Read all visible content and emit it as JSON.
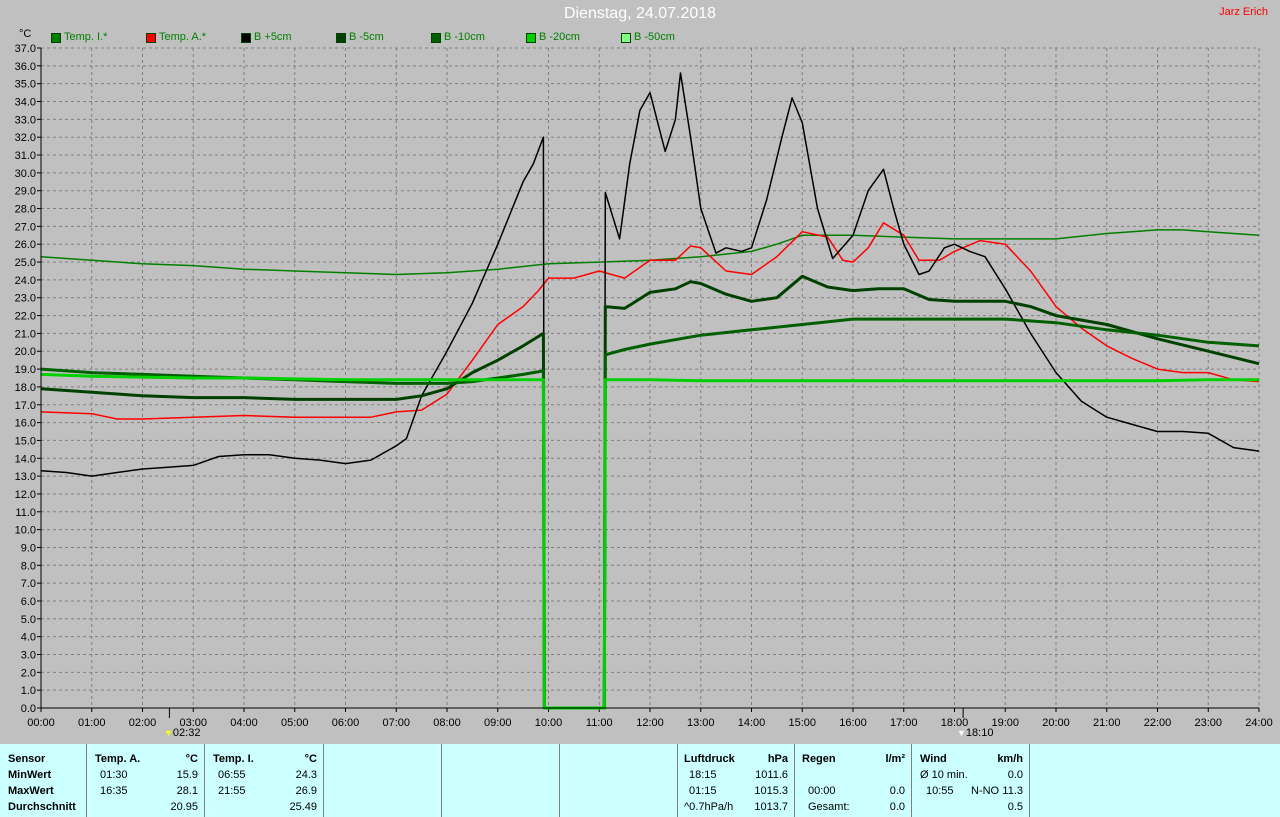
{
  "header": {
    "title": "Dienstag, 24.07.2018",
    "author": "Jarz Erich",
    "unit": "°C"
  },
  "colors": {
    "background": "#c0c0c0",
    "plot": "#ffffff",
    "panel": "#ccffff"
  },
  "markers": [
    {
      "time": 2.53,
      "label": "02:32"
    },
    {
      "time": 18.17,
      "label": "18:10"
    }
  ],
  "chart_data": {
    "type": "line",
    "title": "Dienstag, 24.07.2018",
    "ylabel": "°C",
    "xlim": [
      0,
      24
    ],
    "ylim": [
      0,
      37
    ],
    "x_tick_labels": [
      "00:00",
      "01:00",
      "02:00",
      "03:00",
      "04:00",
      "05:00",
      "06:00",
      "07:00",
      "08:00",
      "09:00",
      "10:00",
      "11:00",
      "12:00",
      "13:00",
      "14:00",
      "15:00",
      "16:00",
      "17:00",
      "18:00",
      "19:00",
      "20:00",
      "21:00",
      "22:00",
      "23:00",
      "24:00"
    ],
    "y_tick_labels": [
      "0.0",
      "1.0",
      "2.0",
      "3.0",
      "4.0",
      "5.0",
      "6.0",
      "7.0",
      "8.0",
      "9.0",
      "10.0",
      "11.0",
      "12.0",
      "13.0",
      "14.0",
      "15.0",
      "16.0",
      "17.0",
      "18.0",
      "19.0",
      "20.0",
      "21.0",
      "22.0",
      "23.0",
      "24.0",
      "25.0",
      "26.0",
      "27.0",
      "28.0",
      "29.0",
      "30.0",
      "31.0",
      "32.0",
      "33.0",
      "34.0",
      "35.0",
      "36.0",
      "37.0"
    ],
    "grid": true,
    "legend_position": "top-left",
    "series": [
      {
        "name": "Temp. I.*",
        "color": "#008000",
        "width": 1.5,
        "points": [
          [
            0,
            25.3
          ],
          [
            1,
            25.1
          ],
          [
            2,
            24.9
          ],
          [
            3,
            24.8
          ],
          [
            4,
            24.6
          ],
          [
            5,
            24.5
          ],
          [
            6,
            24.4
          ],
          [
            7,
            24.3
          ],
          [
            8,
            24.4
          ],
          [
            9,
            24.6
          ],
          [
            10,
            24.9
          ],
          [
            11,
            25.0
          ],
          [
            12,
            25.1
          ],
          [
            13,
            25.3
          ],
          [
            14,
            25.6
          ],
          [
            14.5,
            26.0
          ],
          [
            15,
            26.5
          ],
          [
            16,
            26.5
          ],
          [
            17,
            26.4
          ],
          [
            18,
            26.3
          ],
          [
            19,
            26.3
          ],
          [
            20,
            26.3
          ],
          [
            21,
            26.6
          ],
          [
            22,
            26.8
          ],
          [
            22.5,
            26.8
          ],
          [
            23,
            26.7
          ],
          [
            24,
            26.5
          ]
        ]
      },
      {
        "name": "Temp. A.*",
        "color": "#ff0000",
        "width": 1.5,
        "points": [
          [
            0,
            16.6
          ],
          [
            1,
            16.5
          ],
          [
            1.5,
            16.2
          ],
          [
            2,
            16.2
          ],
          [
            3,
            16.3
          ],
          [
            4,
            16.4
          ],
          [
            5,
            16.3
          ],
          [
            6,
            16.3
          ],
          [
            6.5,
            16.3
          ],
          [
            7,
            16.6
          ],
          [
            7.5,
            16.7
          ],
          [
            8,
            17.6
          ],
          [
            8.5,
            19.5
          ],
          [
            9,
            21.5
          ],
          [
            9.5,
            22.5
          ],
          [
            9.8,
            23.4
          ],
          [
            10,
            24.1
          ],
          [
            10.5,
            24.1
          ],
          [
            11,
            24.5
          ],
          [
            11.5,
            24.1
          ],
          [
            12,
            25.1
          ],
          [
            12.5,
            25.1
          ],
          [
            12.8,
            25.9
          ],
          [
            13,
            25.8
          ],
          [
            13.5,
            24.5
          ],
          [
            14,
            24.3
          ],
          [
            14.5,
            25.3
          ],
          [
            15,
            26.7
          ],
          [
            15.5,
            26.4
          ],
          [
            15.8,
            25.1
          ],
          [
            16,
            25.0
          ],
          [
            16.3,
            25.8
          ],
          [
            16.6,
            27.2
          ],
          [
            17,
            26.5
          ],
          [
            17.3,
            25.1
          ],
          [
            17.7,
            25.1
          ],
          [
            18,
            25.6
          ],
          [
            18.5,
            26.2
          ],
          [
            19,
            26.0
          ],
          [
            19.5,
            24.5
          ],
          [
            20,
            22.5
          ],
          [
            20.5,
            21.3
          ],
          [
            21,
            20.3
          ],
          [
            21.5,
            19.6
          ],
          [
            22,
            19.0
          ],
          [
            22.5,
            18.8
          ],
          [
            23,
            18.8
          ],
          [
            23.5,
            18.4
          ],
          [
            24,
            18.3
          ]
        ]
      },
      {
        "name": "B +5cm",
        "color": "#000000",
        "width": 1.5,
        "points": [
          [
            0,
            13.3
          ],
          [
            0.5,
            13.2
          ],
          [
            1,
            13.0
          ],
          [
            1.5,
            13.2
          ],
          [
            2,
            13.4
          ],
          [
            2.5,
            13.5
          ],
          [
            3,
            13.6
          ],
          [
            3.5,
            14.1
          ],
          [
            4,
            14.2
          ],
          [
            4.5,
            14.2
          ],
          [
            5,
            14.0
          ],
          [
            5.5,
            13.9
          ],
          [
            6,
            13.7
          ],
          [
            6.5,
            13.9
          ],
          [
            7,
            14.7
          ],
          [
            7.2,
            15.1
          ],
          [
            7.5,
            17.5
          ],
          [
            8,
            20.0
          ],
          [
            8.5,
            22.7
          ],
          [
            9,
            26.0
          ],
          [
            9.5,
            29.5
          ],
          [
            9.7,
            30.5
          ],
          [
            9.9,
            32.0
          ],
          [
            9.92,
            0.0
          ],
          [
            11.1,
            0.0
          ],
          [
            11.12,
            28.9
          ],
          [
            11.4,
            26.3
          ],
          [
            11.6,
            30.5
          ],
          [
            11.8,
            33.5
          ],
          [
            12,
            34.5
          ],
          [
            12.3,
            31.2
          ],
          [
            12.5,
            33.0
          ],
          [
            12.6,
            35.6
          ],
          [
            12.8,
            32.0
          ],
          [
            13,
            28.0
          ],
          [
            13.3,
            25.5
          ],
          [
            13.5,
            25.8
          ],
          [
            13.8,
            25.6
          ],
          [
            14,
            25.8
          ],
          [
            14.3,
            28.5
          ],
          [
            14.6,
            32.0
          ],
          [
            14.8,
            34.2
          ],
          [
            15,
            32.8
          ],
          [
            15.3,
            28.0
          ],
          [
            15.6,
            25.2
          ],
          [
            16,
            26.5
          ],
          [
            16.3,
            29.0
          ],
          [
            16.6,
            30.2
          ],
          [
            16.8,
            28.0
          ],
          [
            17,
            26.0
          ],
          [
            17.3,
            24.3
          ],
          [
            17.5,
            24.5
          ],
          [
            17.8,
            25.8
          ],
          [
            18,
            26.0
          ],
          [
            18.3,
            25.6
          ],
          [
            18.6,
            25.3
          ],
          [
            19,
            23.5
          ],
          [
            19.5,
            21.0
          ],
          [
            20,
            18.8
          ],
          [
            20.5,
            17.2
          ],
          [
            21,
            16.3
          ],
          [
            21.5,
            15.9
          ],
          [
            22,
            15.5
          ],
          [
            22.5,
            15.5
          ],
          [
            23,
            15.4
          ],
          [
            23.5,
            14.6
          ],
          [
            24,
            14.4
          ]
        ]
      },
      {
        "name": "B -5cm",
        "color": "#004000",
        "width": 3,
        "points": [
          [
            0,
            17.9
          ],
          [
            1,
            17.7
          ],
          [
            2,
            17.5
          ],
          [
            3,
            17.4
          ],
          [
            4,
            17.4
          ],
          [
            5,
            17.3
          ],
          [
            6,
            17.3
          ],
          [
            7,
            17.3
          ],
          [
            7.5,
            17.5
          ],
          [
            8,
            17.9
          ],
          [
            8.5,
            18.8
          ],
          [
            9,
            19.5
          ],
          [
            9.5,
            20.3
          ],
          [
            9.9,
            21.0
          ],
          [
            9.92,
            0.0
          ],
          [
            11.1,
            0.0
          ],
          [
            11.12,
            22.5
          ],
          [
            11.5,
            22.4
          ],
          [
            12,
            23.3
          ],
          [
            12.5,
            23.5
          ],
          [
            12.8,
            23.9
          ],
          [
            13,
            23.8
          ],
          [
            13.5,
            23.2
          ],
          [
            14,
            22.8
          ],
          [
            14.5,
            23.0
          ],
          [
            15,
            24.2
          ],
          [
            15.5,
            23.6
          ],
          [
            16,
            23.4
          ],
          [
            16.5,
            23.5
          ],
          [
            17,
            23.5
          ],
          [
            17.5,
            22.9
          ],
          [
            18,
            22.8
          ],
          [
            19,
            22.8
          ],
          [
            19.5,
            22.5
          ],
          [
            20,
            22.0
          ],
          [
            21,
            21.5
          ],
          [
            22,
            20.7
          ],
          [
            23,
            20.0
          ],
          [
            24,
            19.3
          ]
        ]
      },
      {
        "name": "B -10cm",
        "color": "#006000",
        "width": 3,
        "points": [
          [
            0,
            19.0
          ],
          [
            1,
            18.8
          ],
          [
            2,
            18.7
          ],
          [
            3,
            18.6
          ],
          [
            4,
            18.5
          ],
          [
            5,
            18.4
          ],
          [
            6,
            18.3
          ],
          [
            7,
            18.2
          ],
          [
            8,
            18.2
          ],
          [
            8.5,
            18.3
          ],
          [
            9,
            18.5
          ],
          [
            9.5,
            18.7
          ],
          [
            9.9,
            18.9
          ],
          [
            9.92,
            0.0
          ],
          [
            11.1,
            0.0
          ],
          [
            11.12,
            19.8
          ],
          [
            11.5,
            20.1
          ],
          [
            12,
            20.4
          ],
          [
            13,
            20.9
          ],
          [
            14,
            21.2
          ],
          [
            15,
            21.5
          ],
          [
            16,
            21.8
          ],
          [
            17,
            21.8
          ],
          [
            18,
            21.8
          ],
          [
            19,
            21.8
          ],
          [
            20,
            21.6
          ],
          [
            21,
            21.2
          ],
          [
            22,
            20.9
          ],
          [
            23,
            20.5
          ],
          [
            24,
            20.3
          ]
        ]
      },
      {
        "name": "B -20cm",
        "color": "#00d000",
        "width": 3,
        "points": [
          [
            0,
            18.7
          ],
          [
            1,
            18.6
          ],
          [
            2,
            18.55
          ],
          [
            3,
            18.5
          ],
          [
            4,
            18.5
          ],
          [
            5,
            18.45
          ],
          [
            6,
            18.4
          ],
          [
            7,
            18.4
          ],
          [
            8,
            18.4
          ],
          [
            9,
            18.4
          ],
          [
            9.9,
            18.4
          ],
          [
            9.92,
            0.0
          ],
          [
            11.1,
            0.0
          ],
          [
            11.12,
            18.4
          ],
          [
            12,
            18.4
          ],
          [
            13,
            18.35
          ],
          [
            14,
            18.35
          ],
          [
            15,
            18.35
          ],
          [
            16,
            18.35
          ],
          [
            17,
            18.35
          ],
          [
            18,
            18.35
          ],
          [
            19,
            18.35
          ],
          [
            20,
            18.35
          ],
          [
            21,
            18.35
          ],
          [
            22,
            18.35
          ],
          [
            23,
            18.4
          ],
          [
            24,
            18.4
          ]
        ]
      },
      {
        "name": "B -50cm",
        "color": "#80ff80",
        "width": 1.5,
        "points": []
      }
    ]
  },
  "summary": {
    "sensor_col": {
      "header": "Sensor",
      "min": "MinWert",
      "max": "MaxWert",
      "avg": "Durchschnitt"
    },
    "temp_a": {
      "header": "Temp. A.",
      "unit": "°C",
      "min_time": "01:30",
      "min_val": "15.9",
      "max_time": "16:35",
      "max_val": "28.1",
      "avg_val": "20.95"
    },
    "temp_i": {
      "header": "Temp. I.",
      "unit": "°C",
      "min_time": "06:55",
      "min_val": "24.3",
      "max_time": "21:55",
      "max_val": "26.9",
      "avg_val": "25.49"
    },
    "pressure": {
      "header": "Luftdruck",
      "unit": "hPa",
      "r1_time": "18:15",
      "r1_val": "1011.6",
      "r2_time": "01:15",
      "r2_val": "1015.3",
      "r3_label": "^0.7hPa/h",
      "r3_val": "1013.7"
    },
    "rain": {
      "header": "Regen",
      "unit": "l/m²",
      "r2_time": "00:00",
      "r2_val": "0.0",
      "r3_label": "Gesamt:",
      "r3_val": "0.0"
    },
    "wind": {
      "header": "Wind",
      "unit": "km/h",
      "r1_label": "Ø 10 min.",
      "r1_val": "0.0",
      "r2_time": "10:55",
      "r2_dir": "N-NO",
      "r2_val": "11.3",
      "r3_val": "0.5"
    }
  }
}
